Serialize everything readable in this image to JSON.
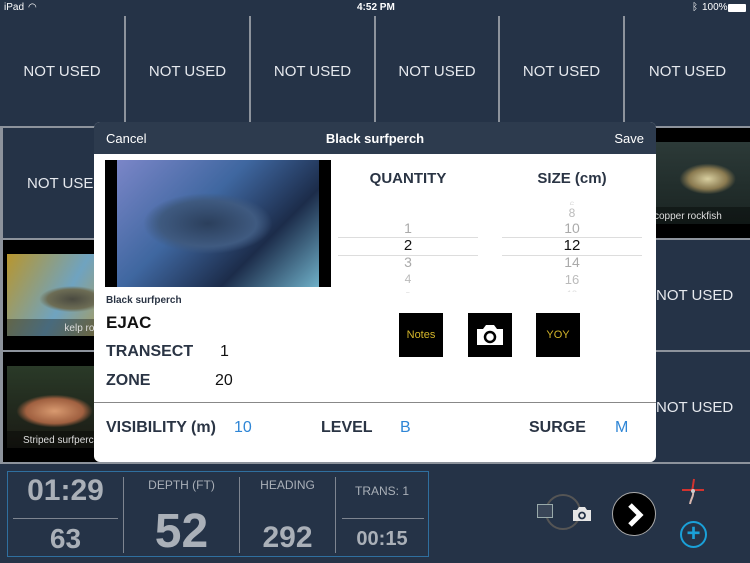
{
  "status_bar": {
    "device": "iPad",
    "time": "4:52 PM",
    "battery": "100%"
  },
  "grid": {
    "row1": [
      "NOT USED",
      "NOT USED",
      "NOT USED",
      "NOT USED",
      "NOT USED",
      "NOT USED"
    ],
    "row2_left": "NOT USED",
    "row2_right": "copper rockfish",
    "row3_left": "kelp rockfish",
    "row3_right": "NOT USED",
    "row4_left": "Striped surfperch",
    "row4_right": "NOT USED"
  },
  "modal": {
    "cancel": "Cancel",
    "title": "Black surfperch",
    "save": "Save",
    "photo_caption": "Black surfperch",
    "code": "EJAC",
    "transect_label": "TRANSECT",
    "transect_value": "1",
    "zone_label": "ZONE",
    "zone_value": "20",
    "quantity_label": "QUANTITY",
    "quantity_options": [
      "1",
      "2",
      "3",
      "4",
      "5"
    ],
    "quantity_selected": "2",
    "size_label": "SIZE (cm)",
    "size_options": [
      "6",
      "8",
      "10",
      "12",
      "14",
      "16",
      "18"
    ],
    "size_selected": "12",
    "notes": "Notes",
    "yoy": "YOY",
    "visibility_label": "VISIBILITY (m)",
    "visibility_value": "10",
    "level_label": "LEVEL",
    "level_value": "B",
    "surge_label": "SURGE",
    "surge_value": "M"
  },
  "dashboard": {
    "time": "01:29",
    "count": "63",
    "depth_label": "DEPTH (FT)",
    "depth": "52",
    "heading_label": "HEADING",
    "heading": "292",
    "trans_label": "TRANS: 1",
    "trans_time": "00:15"
  },
  "colors": {
    "background": "#253347",
    "accent": "#2f86d6",
    "notes_text": "#d4b52a"
  }
}
